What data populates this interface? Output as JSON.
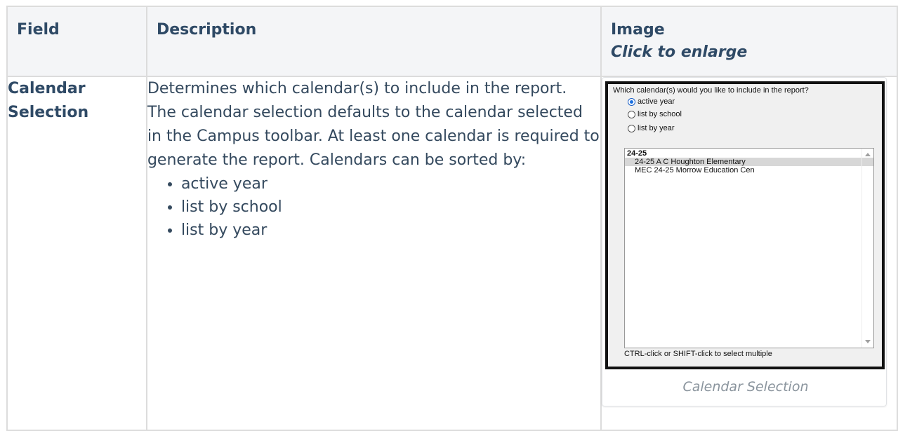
{
  "table": {
    "headers": {
      "field": "Field",
      "description": "Description",
      "image": "Image",
      "image_sub": "Click to enlarge"
    },
    "row": {
      "field_line1": "Calendar",
      "field_line2": "Selection",
      "description": "Determines which calendar(s) to include in the report. The calendar selection defaults to the calendar selected in the Campus toolbar. At least one calendar is required to generate the report. Calendars can be sorted by:",
      "bullets": [
        "active year",
        "list by school",
        "list by year"
      ]
    }
  },
  "screenshot": {
    "question": "Which calendar(s) would you like to include in the report?",
    "radio_options": [
      {
        "label": "active year",
        "checked": true
      },
      {
        "label": "list by school",
        "checked": false
      },
      {
        "label": "list by year",
        "checked": false
      }
    ],
    "list_group": "24-25",
    "list_items": [
      {
        "label": "24-25 A C Houghton Elementary",
        "selected": true
      },
      {
        "label": "MEC 24-25 Morrow Education Cen",
        "selected": false
      }
    ],
    "hint": "CTRL-click or SHIFT-click to select multiple"
  },
  "caption": "Calendar Selection",
  "colors": {
    "header_bg": "#f4f5f7",
    "heading_text": "#2f4a66",
    "body_text": "#34495e",
    "caption_text": "#8a949d",
    "radio_accent": "#1a6fe0"
  }
}
